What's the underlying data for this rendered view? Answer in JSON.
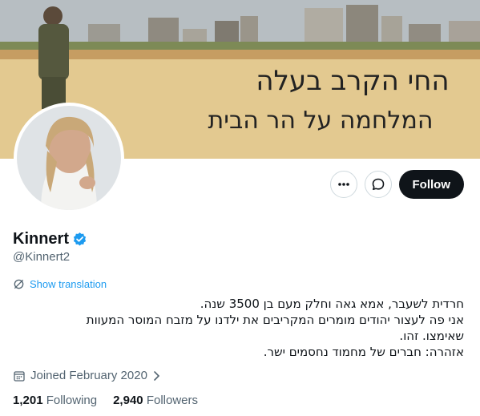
{
  "banner": {
    "graffiti_line1": "החי הקרב בעלה",
    "graffiti_line2": "המלחמה על הר הבית"
  },
  "actions": {
    "more_icon": "more-horizontal-icon",
    "message_icon": "message-icon",
    "follow_label": "Follow"
  },
  "profile": {
    "name": "Kinnert",
    "handle": "@Kinnert2",
    "verified_color": "#1d9bf0",
    "translation_label": "Show translation",
    "bio": "חרדית לשעבר, אמא גאה וחלק מעם בן 3500 שנה.\nאני פה לעצור יהודים מומרים המקריבים את ילדנו על מזבח המוסר המעוות\nשאימצו. זהו.\nאזהרה: חברים של מחמוד נחסמים ישר.",
    "joined": "Joined February 2020",
    "following_count": "1,201",
    "following_label": "Following",
    "followers_count": "2,940",
    "followers_label": "Followers"
  },
  "colors": {
    "accent": "#1d9bf0",
    "follow_bg": "#0f1419",
    "secondary_text": "#536471"
  }
}
